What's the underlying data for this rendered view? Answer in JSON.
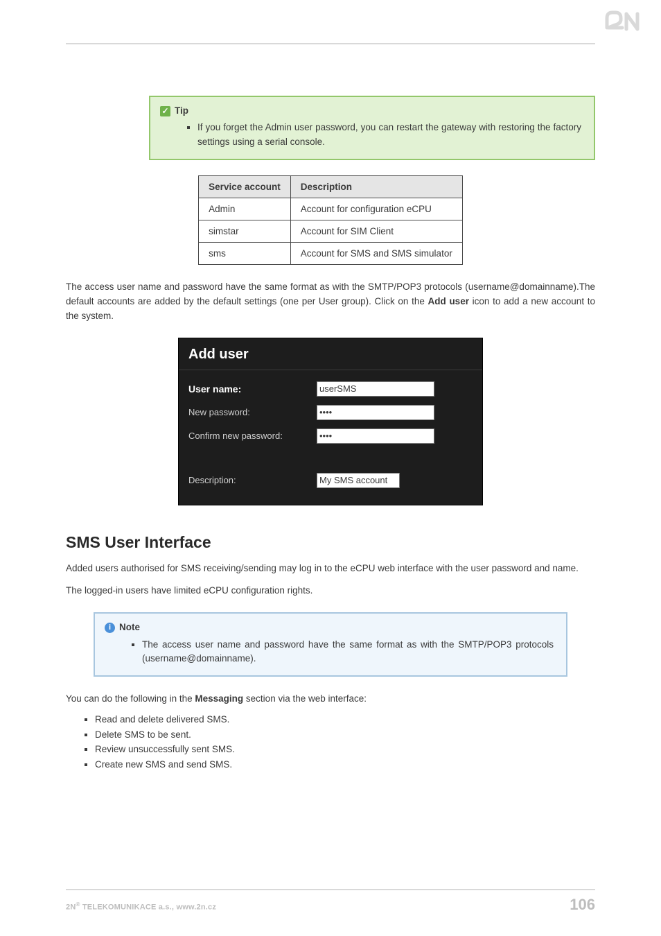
{
  "brand": {
    "logo_alt": "2N"
  },
  "tip": {
    "heading": "Tip",
    "body": "If you forget the Admin user password, you can restart the gateway with restoring the factory settings using a serial console."
  },
  "acct_table": {
    "headers": [
      "Service account",
      "Description"
    ],
    "rows": [
      {
        "account": "Admin",
        "desc": "Account for configuration eCPU"
      },
      {
        "account": "simstar",
        "desc": "Account for SIM Client"
      },
      {
        "account": "sms",
        "desc": "Account for SMS and SMS simulator"
      }
    ]
  },
  "para1_a": "The access user name and password have the same format as with the SMTP/POP3 protocols (username@domainname).The default accounts are added by the default settings (one per User group). Click on the ",
  "para1_bold": "Add user",
  "para1_b": " icon to add a new account to the system.",
  "form": {
    "title": "Add user",
    "rows": {
      "username_label": "User name:",
      "username_value": "userSMS",
      "newpw_label": "New password:",
      "newpw_value": "••••",
      "confpw_label": "Confirm new password:",
      "confpw_value": "••••",
      "desc_label": "Description:",
      "desc_value": "My SMS account"
    }
  },
  "section_heading": "SMS User Interface",
  "para2": "Added users authorised for SMS receiving/sending may log in to the eCPU web interface with the user password and name.",
  "para3": "The logged-in users have limited eCPU configuration rights.",
  "note": {
    "heading": "Note",
    "body": "The access user name and password have the same format as with the SMTP/POP3 protocols (username@domainname)."
  },
  "para4_a": "You can do the following in the ",
  "para4_bold": "Messaging",
  "para4_b": " section via the web interface:",
  "msg_bullets": [
    "Read and delete delivered SMS.",
    "Delete SMS to be sent.",
    "Review unsuccessfully sent SMS.",
    "Create new SMS and send SMS."
  ],
  "footer": {
    "company_a": "2N",
    "company_b": " TELEKOMUNIKACE a.s., www.2n.cz",
    "page": "106"
  }
}
